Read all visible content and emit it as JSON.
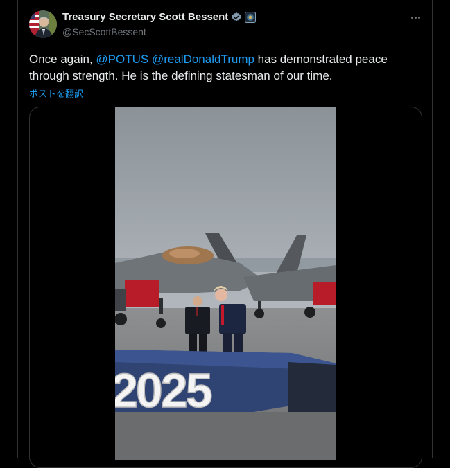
{
  "tweet": {
    "author": {
      "display_name": "Treasury Secretary Scott Bessent",
      "handle": "@SecScottBessent",
      "verified_icon": "verified-badge-icon",
      "affiliation_icon": "treasury-seal-icon"
    },
    "text_prefix": "Once again, ",
    "mention1": "@POTUS",
    "mention2": "@realDonaldTrump",
    "text_suffix": " has demonstrated peace through strength. He is the defining statesman of our time.",
    "translate_label": "ポストを翻訳",
    "more_icon": "more-options-icon"
  },
  "media": {
    "type": "video",
    "year_sign": "2025"
  },
  "colors": {
    "background": "#000000",
    "accent": "#1d9bf0",
    "text": "#e7e9ea",
    "muted": "#71767b",
    "border": "#2f3336"
  }
}
